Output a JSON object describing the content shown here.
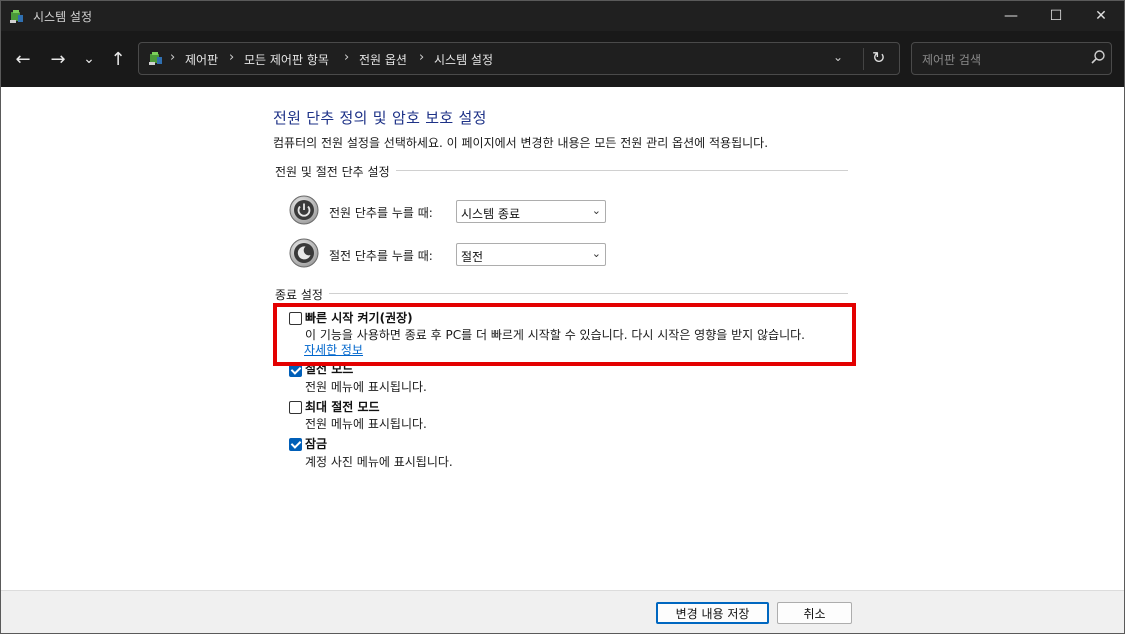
{
  "window": {
    "title": "시스템 설정",
    "minimize_glyph": "—",
    "maximize_glyph": "☐",
    "close_glyph": "✕"
  },
  "nav": {
    "back_glyph": "←",
    "forward_glyph": "→",
    "recent_glyph": "⌄",
    "up_glyph": "↑",
    "breadcrumbs": [
      "제어판",
      "모든 제어판 항목",
      "전원 옵션",
      "시스템 설정"
    ],
    "separator": "›",
    "dropdown_glyph": "⌄",
    "refresh_glyph": "↻"
  },
  "search": {
    "placeholder": "제어판 검색"
  },
  "page": {
    "title": "전원 단추 정의 및 암호 보호 설정",
    "description": "컴퓨터의 전원 설정을 선택하세요. 이 페이지에서 변경한 내용은 모든 전원 관리 옵션에 적용됩니다."
  },
  "power_section": {
    "label": "전원 및 절전 단추 설정",
    "rows": [
      {
        "label": "전원 단추를 누를 때:",
        "value": "시스템 종료",
        "icon": "power-button-icon"
      },
      {
        "label": "절전 단추를 누를 때:",
        "value": "절전",
        "icon": "sleep-button-icon"
      }
    ]
  },
  "shutdown_section": {
    "label": "종료 설정",
    "options": [
      {
        "title": "빠른 시작 켜기(권장)",
        "description": "이 기능을 사용하면 종료 후 PC를 더 빠르게 시작할 수 있습니다. 다시 시작은 영향을 받지 않습니다.",
        "checked": false
      },
      {
        "title": "절전 모드",
        "description": "전원 메뉴에 표시됩니다.",
        "checked": true
      },
      {
        "title": "최대 절전 모드",
        "description": "전원 메뉴에 표시됩니다.",
        "checked": false
      },
      {
        "title": "잠금",
        "description": "계정 사진 메뉴에 표시됩니다.",
        "checked": true
      }
    ],
    "more_info_link": "자세한 정보"
  },
  "footer": {
    "save_label": "변경 내용 저장",
    "cancel_label": "취소"
  },
  "colors": {
    "title_blue": "#1e3287",
    "highlight_red": "#e30000",
    "checkbox_blue": "#005fb8",
    "link_blue": "#0066cc"
  }
}
